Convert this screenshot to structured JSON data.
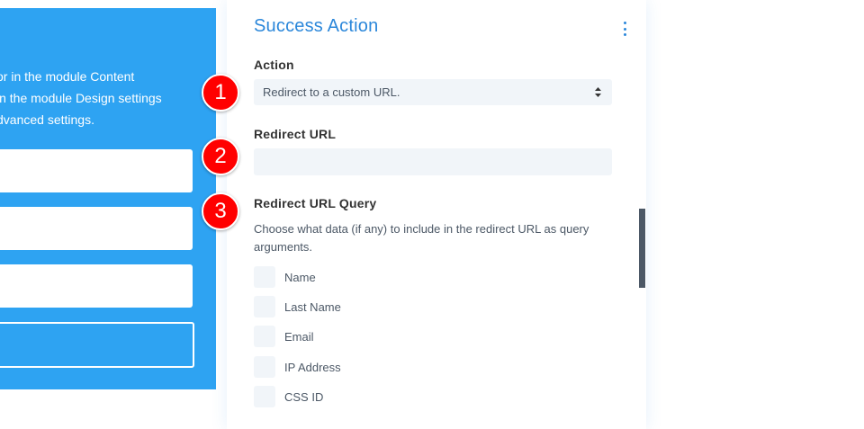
{
  "preview": {
    "lines": [
      "or in the module Content",
      "in the module Design settings",
      "dvanced settings."
    ]
  },
  "panel": {
    "title": "Success Action",
    "action": {
      "label": "Action",
      "selected": "Redirect to a custom URL."
    },
    "redirect_url": {
      "label": "Redirect URL",
      "value": "",
      "placeholder": ""
    },
    "redirect_query": {
      "label": "Redirect URL Query",
      "description": "Choose what data (if any) to include in the redirect URL as query arguments.",
      "options": [
        {
          "label": "Name",
          "checked": false
        },
        {
          "label": "Last Name",
          "checked": false
        },
        {
          "label": "Email",
          "checked": false
        },
        {
          "label": "IP Address",
          "checked": false
        },
        {
          "label": "CSS ID",
          "checked": false
        }
      ]
    }
  },
  "markers": [
    "1",
    "2",
    "3"
  ],
  "colors": {
    "preview_bg": "#2ea3f2",
    "accent": "#2b87da",
    "marker": "#ff0000",
    "field_bg": "#f1f5f9"
  }
}
